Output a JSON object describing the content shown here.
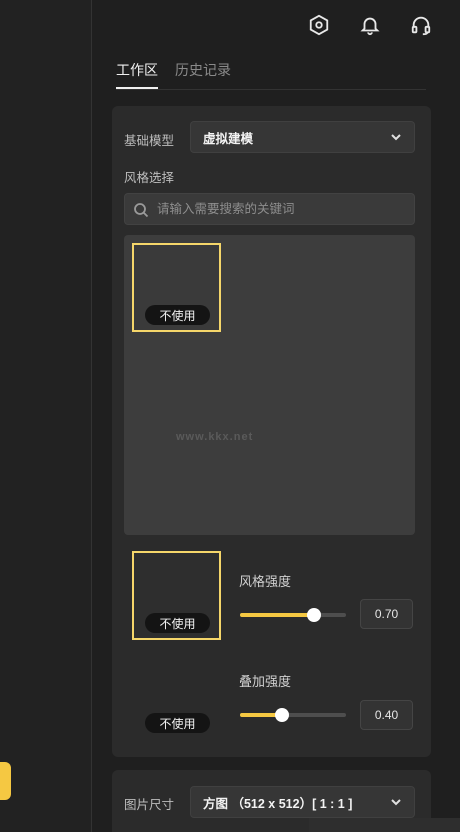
{
  "tabs": {
    "workspace": "工作区",
    "history": "历史记录"
  },
  "base_model": {
    "label": "基础模型",
    "value": "虚拟建模"
  },
  "style": {
    "label": "风格选择",
    "search_placeholder": "请输入需要搜索的关键词",
    "gallery_tile_caption": "不使用",
    "watermark": "www.kkx.net"
  },
  "style_strength": {
    "tile_caption": "不使用",
    "label": "风格强度",
    "value": "0.70",
    "level": 0.7
  },
  "overlay_strength": {
    "tile_caption": "不使用",
    "label": "叠加强度",
    "value": "0.40",
    "level": 0.4
  },
  "image_size": {
    "label": "图片尺寸",
    "value": "方图 （512 x 512）[ 1 : 1 ]"
  },
  "colors": {
    "accent": "#f5c842",
    "tile_border": "#f5d66a",
    "background": "#1f1f1f",
    "card": "#2b2b2b"
  },
  "icons": [
    "settings-hex-icon",
    "bell-icon",
    "headset-icon",
    "chevron-down-icon",
    "search-icon"
  ]
}
